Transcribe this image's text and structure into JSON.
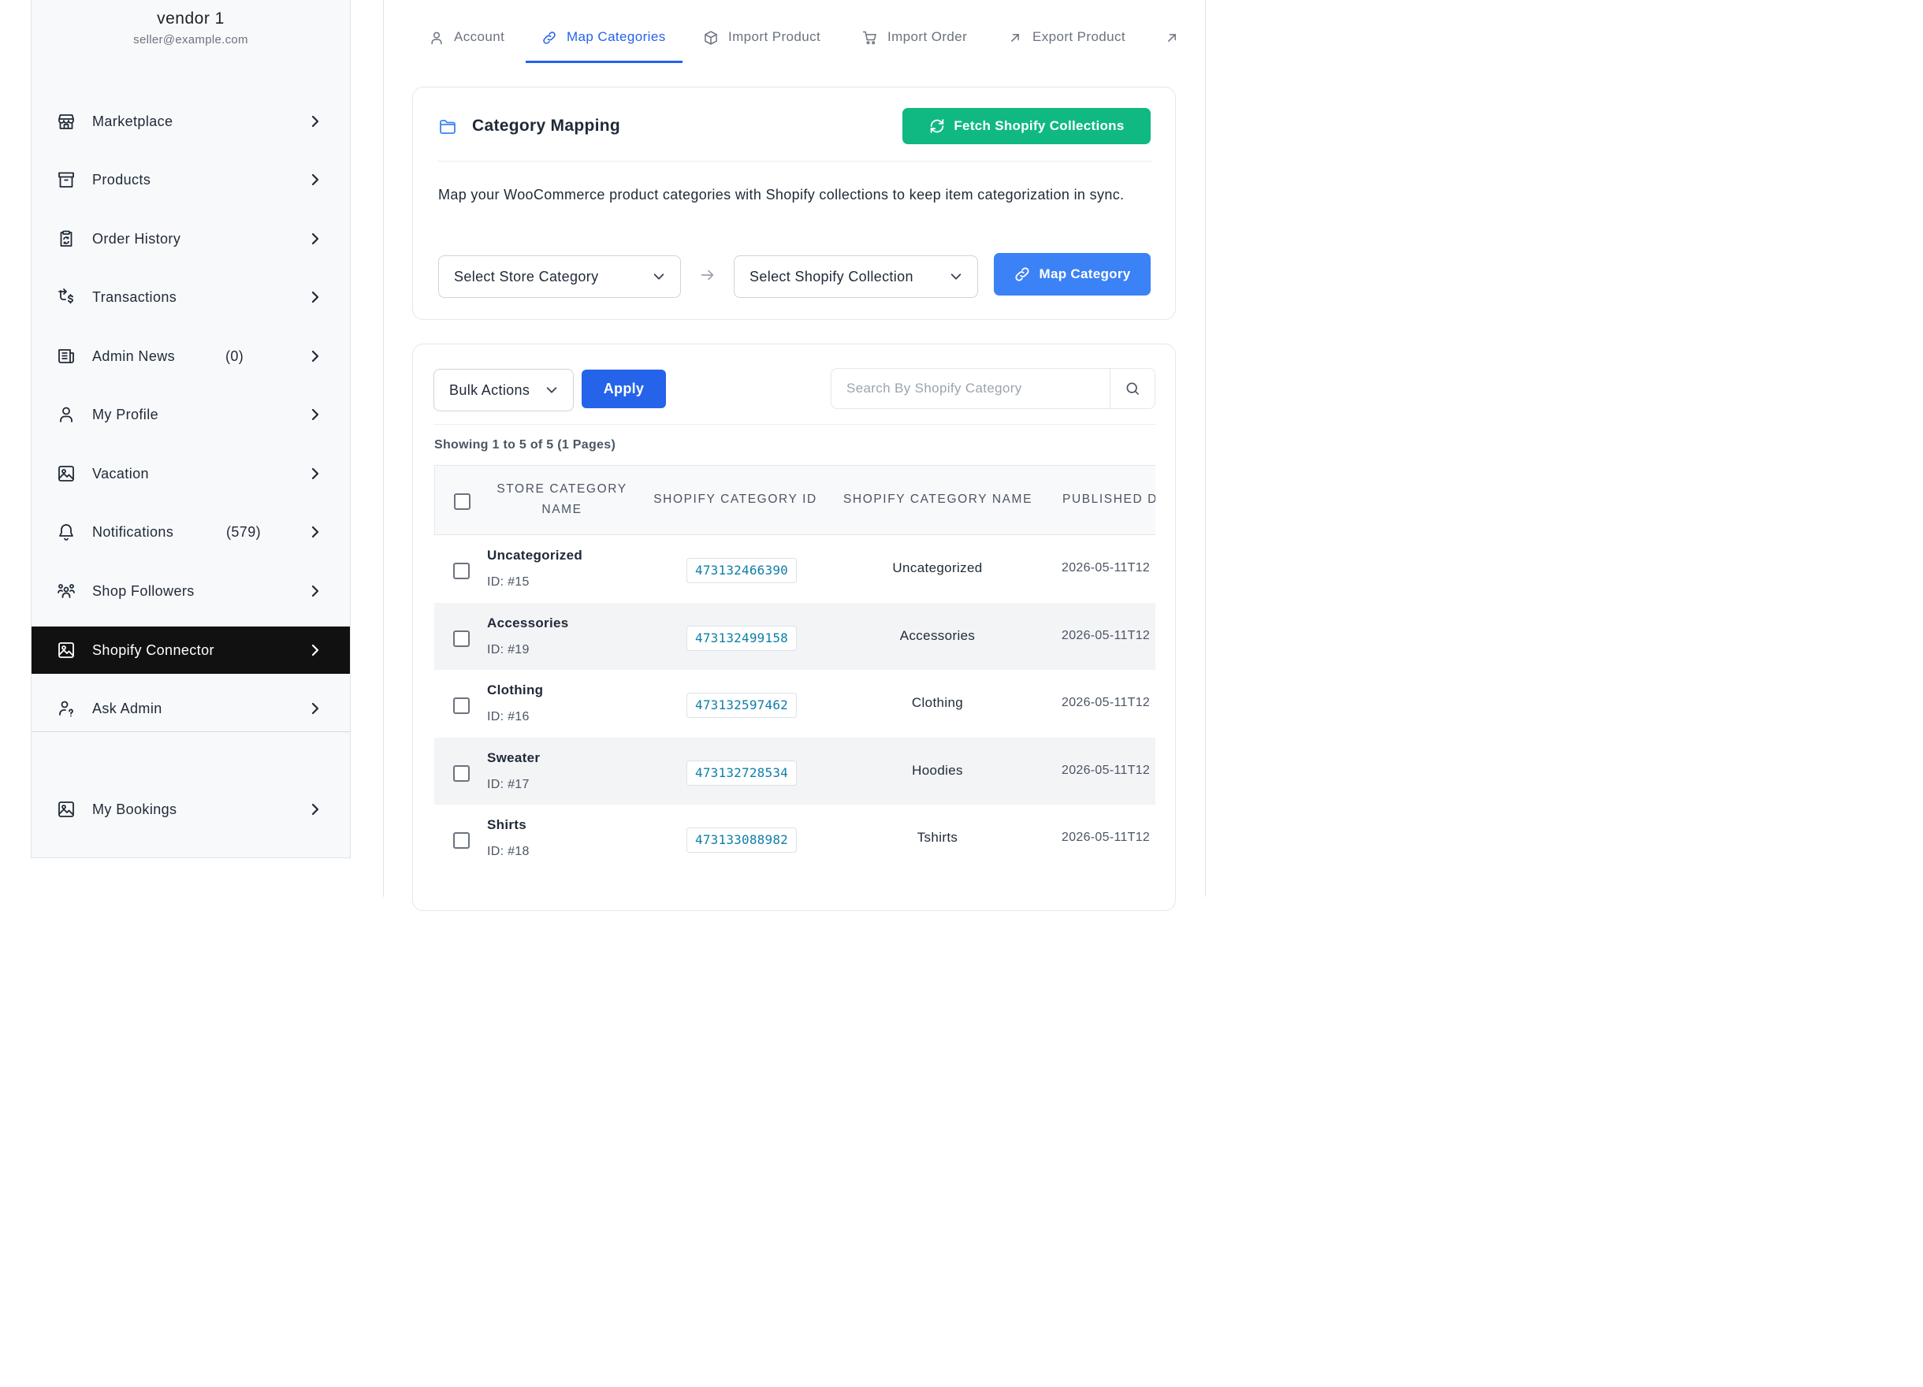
{
  "sidebar": {
    "vendor_name": "vendor 1",
    "vendor_email": "seller@example.com",
    "items": [
      {
        "label": "Marketplace",
        "icon": "store-icon",
        "count": ""
      },
      {
        "label": "Products",
        "icon": "archive-box-icon",
        "count": ""
      },
      {
        "label": "Order History",
        "icon": "clipboard-refresh-icon",
        "count": ""
      },
      {
        "label": "Transactions",
        "icon": "transactions-dollar-icon",
        "count": ""
      },
      {
        "label": "Admin News",
        "icon": "newspaper-icon",
        "count": "(0)"
      },
      {
        "label": "My Profile",
        "icon": "user-icon",
        "count": ""
      },
      {
        "label": "Vacation",
        "icon": "image-icon",
        "count": ""
      },
      {
        "label": "Notifications",
        "icon": "bell-icon",
        "count": "(579)"
      },
      {
        "label": "Shop Followers",
        "icon": "users-group-icon",
        "count": ""
      },
      {
        "label": "Shopify Connector",
        "icon": "image-icon",
        "count": "",
        "active": true
      },
      {
        "label": "Ask Admin",
        "icon": "user-question-icon",
        "count": ""
      },
      {
        "label": "My Bookings",
        "icon": "image-icon",
        "count": ""
      }
    ]
  },
  "tabs": [
    {
      "label": "Account",
      "icon": "user-icon"
    },
    {
      "label": "Map Categories",
      "icon": "link-icon",
      "active": true
    },
    {
      "label": "Import Product",
      "icon": "cube-icon"
    },
    {
      "label": "Import Order",
      "icon": "cart-icon"
    },
    {
      "label": "Export Product",
      "icon": "arrow-up-right-icon"
    },
    {
      "label": "",
      "icon": "arrow-up-right-icon"
    }
  ],
  "mapping": {
    "title": "Category Mapping",
    "fetch_button": "Fetch Shopify Collections",
    "description": "Map your WooCommerce product categories with Shopify collections to keep item categorization in sync.",
    "store_select": "Select Store Category",
    "shopify_select": "Select Shopify Collection",
    "map_button": "Map Category"
  },
  "listing": {
    "bulk_actions": "Bulk Actions",
    "apply_button": "Apply",
    "search_placeholder": "Search By Shopify Category",
    "showing": "Showing 1 to 5 of 5 (1 Pages)",
    "columns": {
      "store_category_line1": "STORE CATEGORY",
      "store_category_line2": "NAME",
      "shopify_category_id": "SHOPIFY CATEGORY ID",
      "shopify_category_name": "SHOPIFY CATEGORY NAME",
      "published": "PUBLISHED D"
    },
    "rows": [
      {
        "name": "Uncategorized",
        "id": "ID: #15",
        "shopify_id": "473132466390",
        "shopify_name": "Uncategorized",
        "published": "2026-05-11T12"
      },
      {
        "name": "Accessories",
        "id": "ID: #19",
        "shopify_id": "473132499158",
        "shopify_name": "Accessories",
        "published": "2026-05-11T12"
      },
      {
        "name": "Clothing",
        "id": "ID: #16",
        "shopify_id": "473132597462",
        "shopify_name": "Clothing",
        "published": "2026-05-11T12"
      },
      {
        "name": "Sweater",
        "id": "ID: #17",
        "shopify_id": "473132728534",
        "shopify_name": "Hoodies",
        "published": "2026-05-11T12"
      },
      {
        "name": "Shirts",
        "id": "ID: #18",
        "shopify_id": "473133088982",
        "shopify_name": "Tshirts",
        "published": "2026-05-11T12"
      }
    ]
  },
  "colors": {
    "accent_blue": "#2563eb",
    "map_button": "#3b82f6",
    "fetch_button": "#10b981",
    "active_nav": "#111111"
  }
}
